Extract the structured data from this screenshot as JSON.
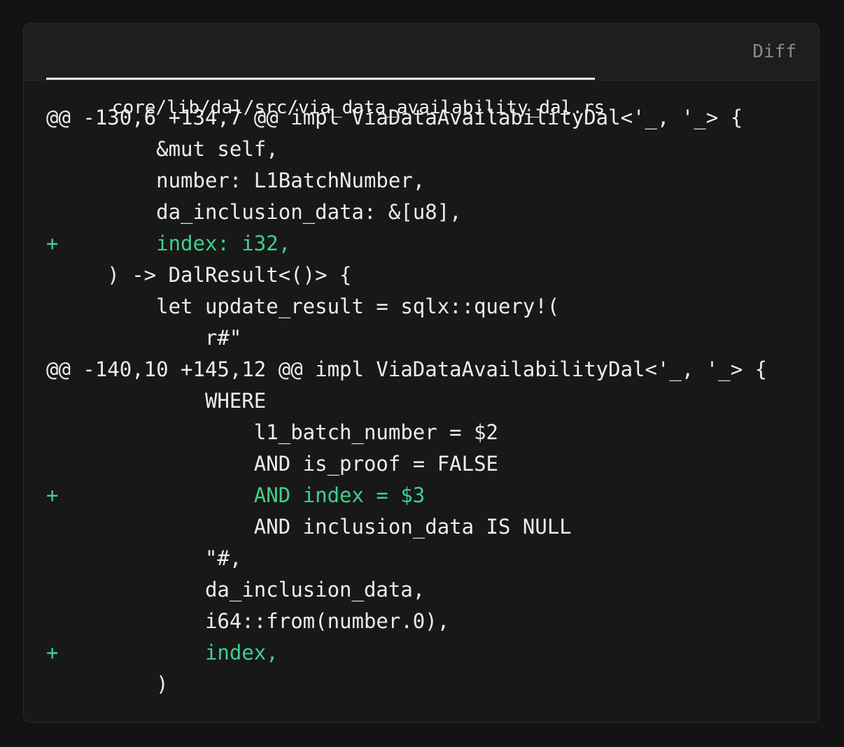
{
  "file": {
    "path": "core/lib/dal/src/via_data_availability_dal.rs",
    "view_label": "Diff"
  },
  "lines": [
    {
      "type": "hunk",
      "text": "@@ -130,6 +134,7 @@ impl ViaDataAvailabilityDal<'_, '_> {"
    },
    {
      "type": "context",
      "text": "         &mut self,"
    },
    {
      "type": "context",
      "text": "         number: L1BatchNumber,"
    },
    {
      "type": "context",
      "text": "         da_inclusion_data: &[u8],"
    },
    {
      "type": "added",
      "text": "+        index: i32,"
    },
    {
      "type": "context",
      "text": "     ) -> DalResult<()> {"
    },
    {
      "type": "context",
      "text": "         let update_result = sqlx::query!("
    },
    {
      "type": "context",
      "text": "             r#\""
    },
    {
      "type": "hunk",
      "text": "@@ -140,10 +145,12 @@ impl ViaDataAvailabilityDal<'_, '_> {"
    },
    {
      "type": "context",
      "text": "             WHERE"
    },
    {
      "type": "context",
      "text": "                 l1_batch_number = $2"
    },
    {
      "type": "context",
      "text": "                 AND is_proof = FALSE"
    },
    {
      "type": "added",
      "text": "+                AND index = $3"
    },
    {
      "type": "context",
      "text": "                 AND inclusion_data IS NULL"
    },
    {
      "type": "context",
      "text": "             \"#,"
    },
    {
      "type": "context",
      "text": "             da_inclusion_data,"
    },
    {
      "type": "context",
      "text": "             i64::from(number.0),"
    },
    {
      "type": "added",
      "text": "+            index,"
    },
    {
      "type": "context",
      "text": "         )"
    }
  ]
}
